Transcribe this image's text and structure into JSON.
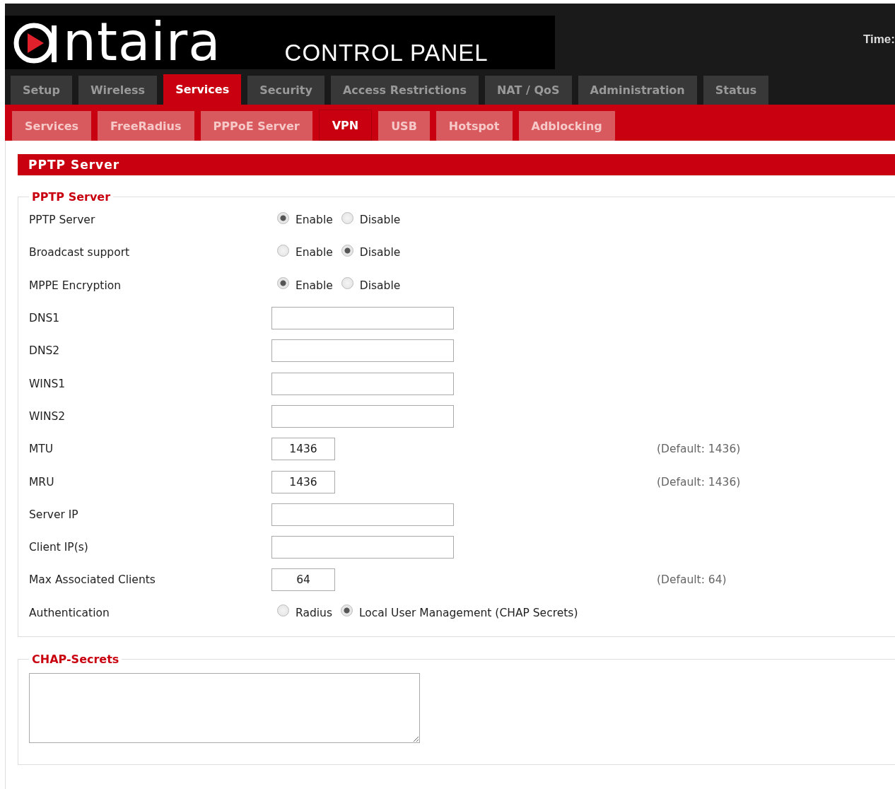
{
  "header": {
    "logo": "ntaira",
    "subtitle": "CONTROL PANEL",
    "time_label": "Time:"
  },
  "main_tabs": [
    {
      "label": "Setup",
      "selected": false
    },
    {
      "label": "Wireless",
      "selected": false
    },
    {
      "label": "Services",
      "selected": true
    },
    {
      "label": "Security",
      "selected": false
    },
    {
      "label": "Access Restrictions",
      "selected": false
    },
    {
      "label": "NAT / QoS",
      "selected": false
    },
    {
      "label": "Administration",
      "selected": false
    },
    {
      "label": "Status",
      "selected": false
    }
  ],
  "sub_tabs": [
    {
      "label": "Services",
      "selected": false
    },
    {
      "label": "FreeRadius",
      "selected": false
    },
    {
      "label": "PPPoE Server",
      "selected": false
    },
    {
      "label": "VPN",
      "selected": true
    },
    {
      "label": "USB",
      "selected": false
    },
    {
      "label": "Hotspot",
      "selected": false
    },
    {
      "label": "Adblocking",
      "selected": false
    }
  ],
  "section_title": "PPTP Server",
  "fieldset": {
    "legend": "PPTP Server",
    "rows": [
      {
        "label": "PPTP Server",
        "kind": "radio",
        "options": [
          {
            "label": "Enable",
            "selected": true
          },
          {
            "label": "Disable",
            "selected": false
          }
        ]
      },
      {
        "label": "Broadcast support",
        "kind": "radio",
        "options": [
          {
            "label": "Enable",
            "selected": false
          },
          {
            "label": "Disable",
            "selected": true
          }
        ]
      },
      {
        "label": "MPPE Encryption",
        "kind": "radio",
        "options": [
          {
            "label": "Enable",
            "selected": true
          },
          {
            "label": "Disable",
            "selected": false
          }
        ]
      },
      {
        "label": "DNS1",
        "kind": "text"
      },
      {
        "label": "DNS2",
        "kind": "text"
      },
      {
        "label": "WINS1",
        "kind": "text"
      },
      {
        "label": "WINS2",
        "kind": "text"
      },
      {
        "label": "MTU",
        "kind": "number",
        "value": "1436",
        "default": "(Default: 1436)"
      },
      {
        "label": "MRU",
        "kind": "number",
        "value": "1436",
        "default": "(Default: 1436)"
      },
      {
        "label": "Server IP",
        "kind": "text"
      },
      {
        "label": "Client IP(s)",
        "kind": "text"
      },
      {
        "label": "Max Associated Clients",
        "kind": "number",
        "value": "64",
        "default": "(Default: 64)"
      },
      {
        "label": "Authentication",
        "kind": "radio",
        "options": [
          {
            "label": "Radius",
            "selected": false
          },
          {
            "label": "Local User Management (CHAP Secrets)",
            "selected": true
          }
        ]
      }
    ]
  },
  "chap_secrets": {
    "legend": "CHAP-Secrets"
  }
}
